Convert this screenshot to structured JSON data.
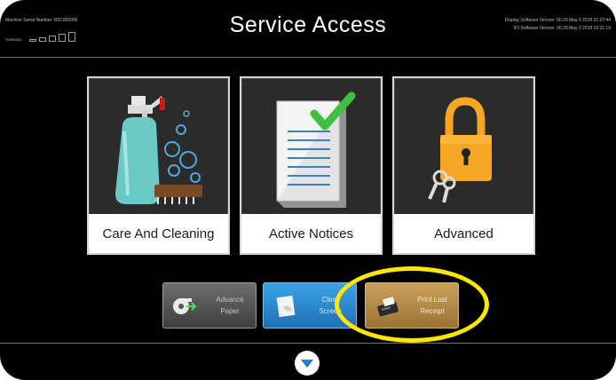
{
  "header": {
    "serial_text": "Machine Serial Number: B2C000000",
    "signal_label": "RUNNING",
    "title": "Service Access",
    "display_version": "Display Software Version: 00.29 May 3 2018 21:27:44",
    "io_version": "I/O Software Version: 00.29 May 3 2018 16:31:19"
  },
  "tiles": [
    {
      "label": "Care And Cleaning",
      "icon": "spray-bottle-icon"
    },
    {
      "label": "Active Notices",
      "icon": "checklist-icon"
    },
    {
      "label": "Advanced",
      "icon": "padlock-icon"
    }
  ],
  "buttons": {
    "advance_paper": {
      "line1": "Advance",
      "line2": "Paper"
    },
    "clear_screen": {
      "line1": "Clear",
      "line2": "Screen"
    },
    "print_last_receipt": {
      "line1": "Print Last",
      "line2": "Receipt"
    }
  },
  "colors": {
    "background": "#000000",
    "highlight": "#ffe800",
    "advance_button": "#5a5a5a",
    "clear_button": "#2b88cf",
    "print_button": "#b58a45",
    "checkmark": "#3fbf3f",
    "padlock": "#f5a623"
  },
  "icons": {
    "home": "home-chevron-icon"
  }
}
